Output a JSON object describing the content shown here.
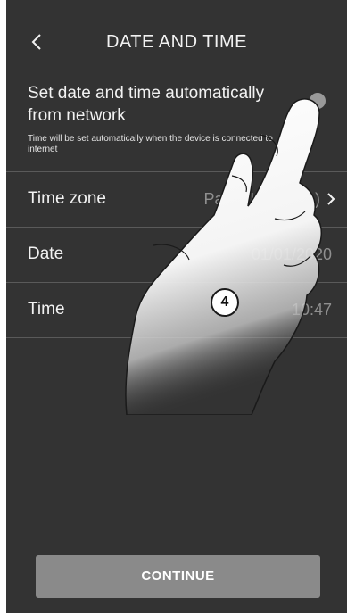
{
  "header": {
    "title": "DATE AND TIME",
    "back_icon": "chevron-left-icon"
  },
  "auto_setting": {
    "title": "Set date and time automatically from network",
    "description": "Time will be set automatically when the device is connected to internet",
    "toggle_on": false,
    "toggle_color": "#9a9a9a"
  },
  "rows": [
    {
      "label": "Time zone",
      "value": "Paris (UTC +01)",
      "icon": "chevron-right-icon"
    },
    {
      "label": "Date",
      "value": "01/01/2020"
    },
    {
      "label": "Time",
      "value": "10:47"
    }
  ],
  "annotation": {
    "step_number": "4"
  },
  "footer": {
    "continue_label": "CONTINUE"
  },
  "colors": {
    "background": "#333333",
    "text": "#f2f2f2",
    "muted_value": "#8f8f8f",
    "divider": "#5a5a5a",
    "button": "#8a8a8a"
  }
}
